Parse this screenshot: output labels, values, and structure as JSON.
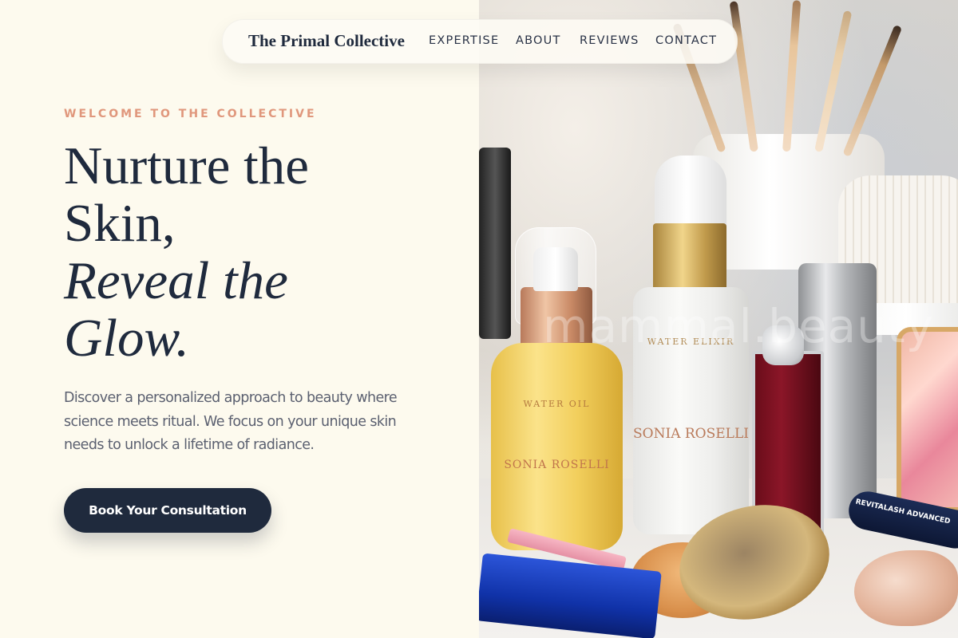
{
  "nav": {
    "brand": "The Primal Collective",
    "links": [
      "EXPERTISE",
      "ABOUT",
      "REVIEWS",
      "CONTACT"
    ]
  },
  "hero": {
    "eyebrow": "WELCOME TO THE COLLECTIVE",
    "headline_line1": "Nurture the",
    "headline_line2": "Skin,",
    "headline_line3": "Reveal the",
    "headline_line4": "Glow.",
    "description": "Discover a personalized approach to beauty where science meets ritual. We focus on your unique skin needs to unlock a lifetime of radiance.",
    "cta_label": "Book Your Consultation"
  },
  "photo": {
    "watermark": "mammal.beauty",
    "oil_bottle_label": "WATER OIL",
    "oil_bottle_brand": "SONIA ROSELLI",
    "serum_label": "WATER ELIXIR",
    "serum_brand": "SONIA ROSELLI",
    "lash_label": "REVITALASH ADVANCED"
  },
  "colors": {
    "background": "#FDFAEE",
    "navy": "#1F2A3D",
    "accent": "#E0977C",
    "body_text": "#5B6070"
  }
}
